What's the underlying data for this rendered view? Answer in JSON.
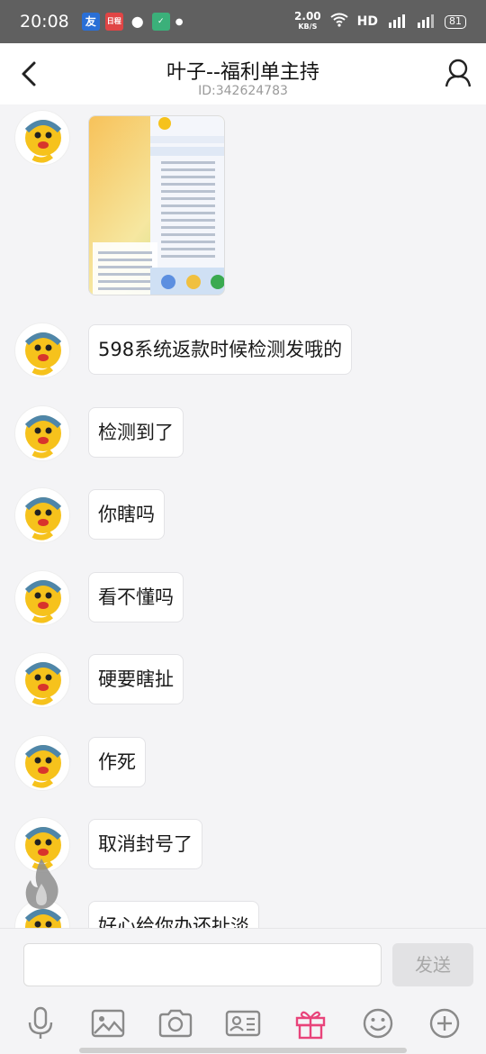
{
  "status_bar": {
    "time": "20:08",
    "app_icons": [
      "友",
      "日程",
      "微信",
      "应用"
    ],
    "net_speed_value": "2.00",
    "net_speed_unit": "KB/S",
    "hd": "HD",
    "battery": "81"
  },
  "header": {
    "title": "叶子--福利单主持",
    "subtitle": "ID:342624783"
  },
  "messages": [
    {
      "type": "image"
    },
    {
      "type": "text",
      "text": "598系统返款时候检测发哦的"
    },
    {
      "type": "text",
      "text": "检测到了"
    },
    {
      "type": "text",
      "text": "你瞎吗"
    },
    {
      "type": "text",
      "text": "看不懂吗"
    },
    {
      "type": "text",
      "text": "硬要瞎扯"
    },
    {
      "type": "text",
      "text": "作死"
    },
    {
      "type": "text",
      "text": "取消封号了"
    },
    {
      "type": "text",
      "text": "好心给你办还扯淡"
    }
  ],
  "input": {
    "value": "",
    "send_label": "发送"
  },
  "toolbar": [
    "mic-icon",
    "image-icon",
    "camera-icon",
    "contact-card-icon",
    "gift-icon",
    "emoji-icon",
    "plus-icon"
  ],
  "colors": {
    "status_bar": "#606060",
    "gift": "#e8437a",
    "icon": "#8a8a8a"
  }
}
